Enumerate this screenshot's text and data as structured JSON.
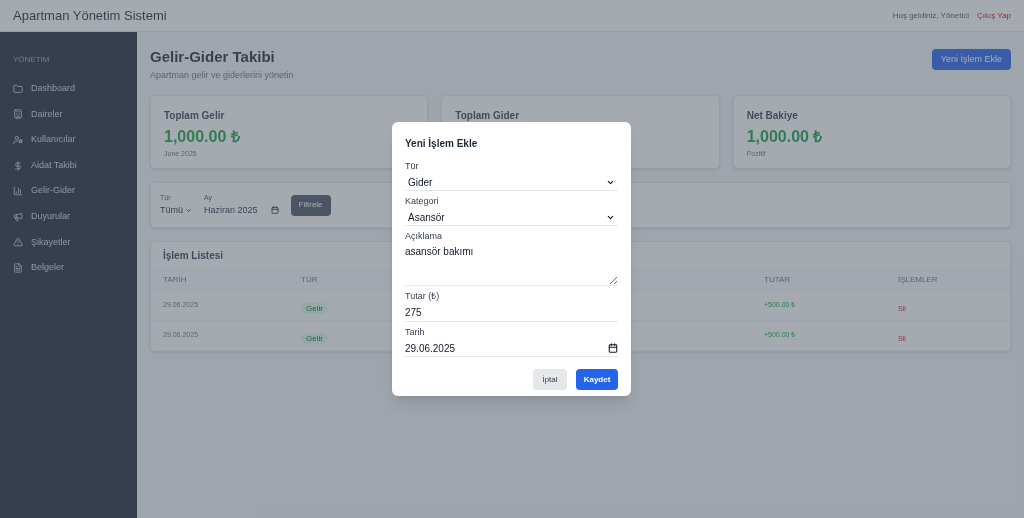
{
  "header": {
    "title": "Apartman Yönetim Sistemi",
    "greeting": "Hoş geldiniz, Yönetici",
    "logout": "Çıkış Yap"
  },
  "sidebar": {
    "section": "YÖNETİM",
    "items": [
      {
        "label": "Dashboard"
      },
      {
        "label": "Daireler"
      },
      {
        "label": "Kullanıcılar"
      },
      {
        "label": "Aidat Takibi"
      },
      {
        "label": "Gelir-Gider"
      },
      {
        "label": "Duyurular"
      },
      {
        "label": "Şikayetler"
      },
      {
        "label": "Belgeler"
      }
    ]
  },
  "page": {
    "title": "Gelir-Gider Takibi",
    "subtitle": "Apartman gelir ve giderlerini yönetin",
    "add_button": "Yeni İşlem Ekle"
  },
  "cards": [
    {
      "title": "Toplam Gelir",
      "value": "1,000.00 ₺",
      "note": "June 2025"
    },
    {
      "title": "Toplam Gider"
    },
    {
      "title": "Net Bakiye",
      "value": "1,000.00 ₺",
      "note": "Pozitif"
    }
  ],
  "filter": {
    "type_label": "Tür",
    "type_value": "Tümü",
    "month_label": "Ay",
    "month_value": "Haziran 2025",
    "button": "Filtrele"
  },
  "table": {
    "title": "İşlem Listesi",
    "columns": [
      "TARİH",
      "TÜR",
      "TUTAR",
      "İŞLEMLER"
    ],
    "rows": [
      {
        "date": "29.06.2025",
        "type": "Gelir",
        "amount": "+500.00 ₺",
        "action": "Sil"
      },
      {
        "date": "29.06.2025",
        "type": "Gelir",
        "amount": "+500.00 ₺",
        "action": "Sil"
      }
    ]
  },
  "modal": {
    "title": "Yeni İşlem Ekle",
    "fields": [
      {
        "kind": "select",
        "label": "Tür",
        "value": "Gider"
      },
      {
        "kind": "select",
        "label": "Kategori",
        "value": "Asansör"
      },
      {
        "kind": "textarea",
        "label": "Açıklama",
        "value": "asansör bakımı"
      },
      {
        "kind": "input",
        "label": "Tutar (₺)",
        "value": "275"
      },
      {
        "kind": "date",
        "label": "Tarih",
        "value": "29.06.2025"
      }
    ],
    "cancel": "İptal",
    "save": "Kaydet"
  }
}
